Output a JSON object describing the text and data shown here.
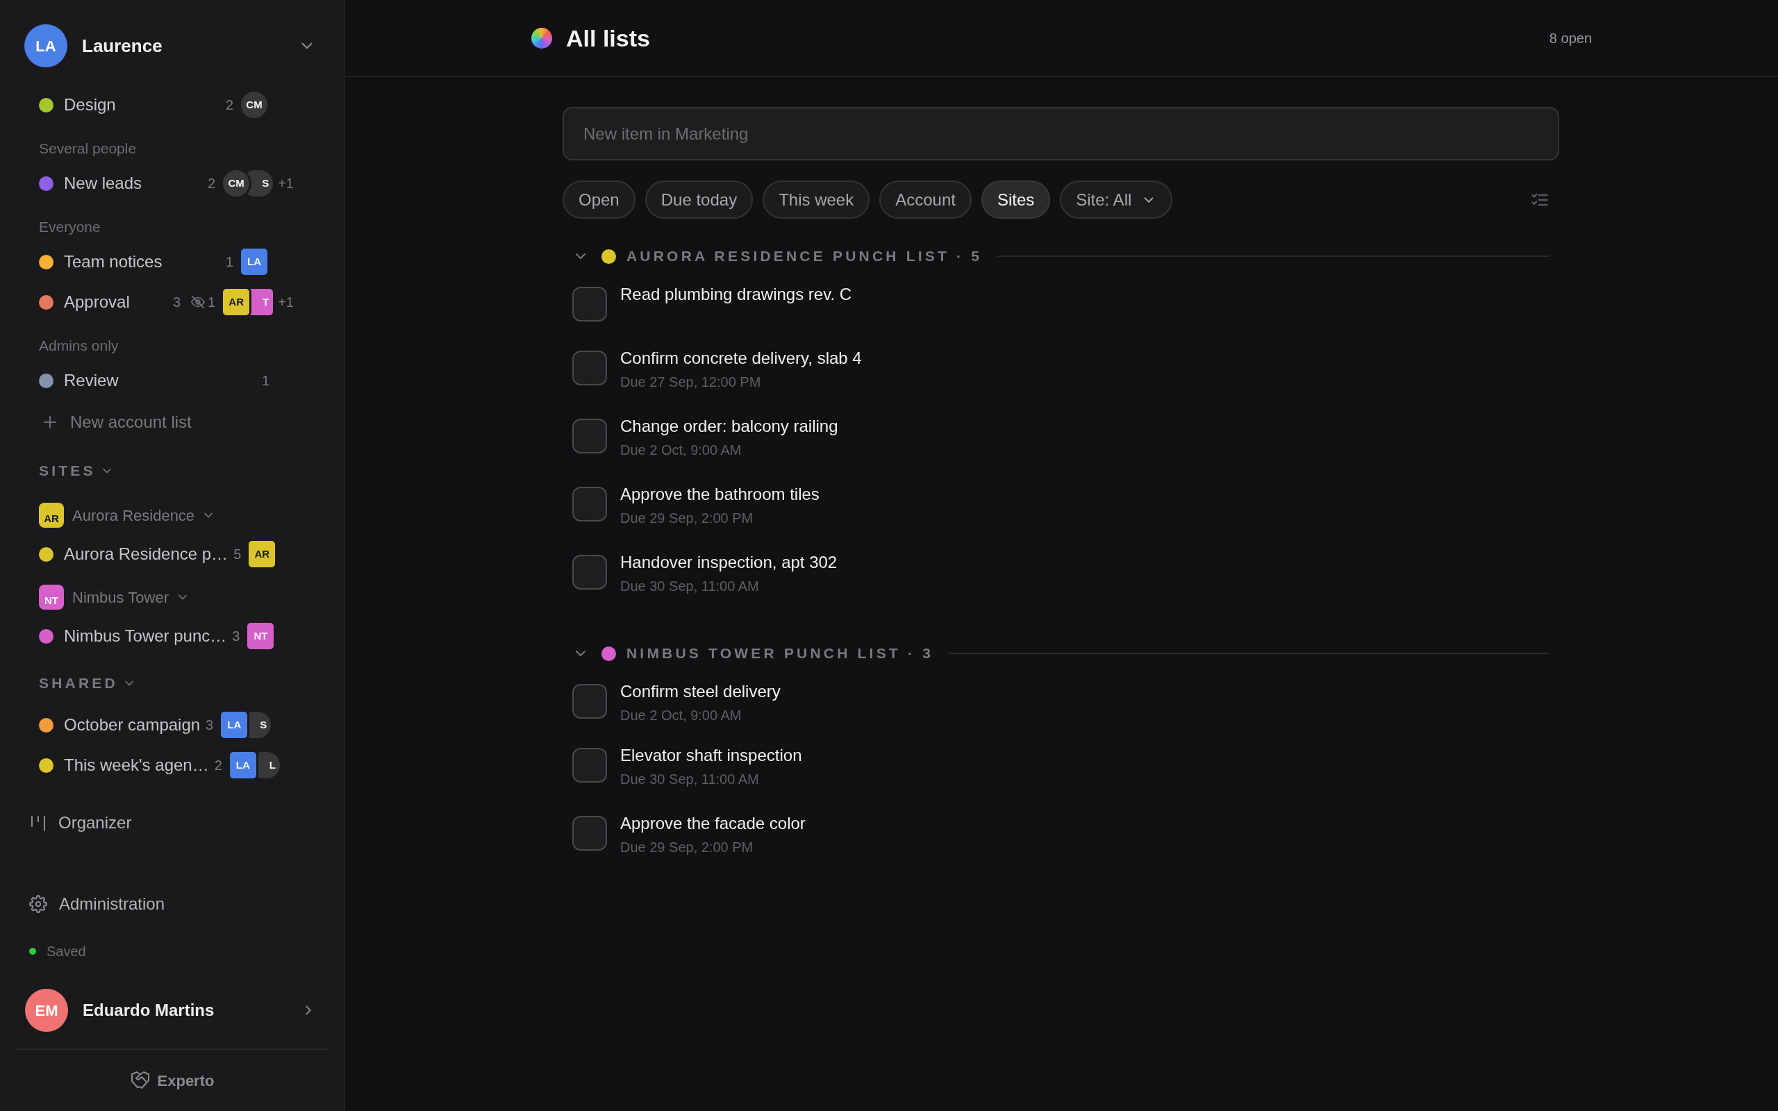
{
  "sidebar": {
    "account": {
      "initials": "LA",
      "name": "Laurence",
      "color": "#4a7fe8"
    },
    "items": [
      {
        "kind": "list",
        "name": "Design",
        "color": "#a3c52d",
        "count": "2",
        "avatars": [
          {
            "initials": "CM",
            "kind": "circle",
            "color": "#38383b",
            "dark_text": false
          }
        ]
      },
      {
        "kind": "label",
        "text": "Several people"
      },
      {
        "kind": "list",
        "name": "New leads",
        "color": "#8f5fe8",
        "count": "2",
        "avatars": [
          {
            "initials": "CM",
            "kind": "circle",
            "color": "#38383b",
            "dark_text": false
          },
          {
            "initials": "S",
            "kind": "circle",
            "color": "#38383b",
            "dark_text": false
          }
        ],
        "more": "+1"
      },
      {
        "kind": "label",
        "text": "Everyone"
      },
      {
        "kind": "list",
        "name": "Team notices",
        "color": "#f5b234",
        "count": "1",
        "avatars": [
          {
            "initials": "LA",
            "kind": "square",
            "color": "#4a7fe8",
            "dark_text": false
          }
        ]
      },
      {
        "kind": "list",
        "name": "Approval",
        "color": "#e07a5f",
        "count": "3",
        "hidden": "1",
        "avatars": [
          {
            "initials": "AR",
            "kind": "square",
            "color": "#dcc52a",
            "dark_text": true
          },
          {
            "initials": "T",
            "kind": "square",
            "color": "#d65fc9",
            "dark_text": false
          }
        ],
        "more": "+1"
      },
      {
        "kind": "label",
        "text": "Admins only"
      },
      {
        "kind": "list",
        "name": "Review",
        "color": "#8493ab",
        "count": "1"
      },
      {
        "kind": "add",
        "text": "New account list"
      },
      {
        "kind": "section",
        "text": "SITES",
        "expanded": true
      },
      {
        "kind": "site",
        "badge": "AR",
        "name": "Aurora Residence",
        "color": "#dcc52a",
        "dark_text": true,
        "expanded": true
      },
      {
        "kind": "list",
        "name": "Aurora Residence p…",
        "color": "#dcc52a",
        "count": "5",
        "avatars": [
          {
            "initials": "AR",
            "kind": "square",
            "color": "#dcc52a",
            "dark_text": true
          }
        ]
      },
      {
        "kind": "site",
        "badge": "NT",
        "name": "Nimbus Tower",
        "color": "#d65fc9",
        "dark_text": false,
        "expanded": true
      },
      {
        "kind": "list",
        "name": "Nimbus Tower punc…",
        "color": "#d65fc9",
        "count": "3",
        "avatars": [
          {
            "initials": "NT",
            "kind": "square",
            "color": "#d65fc9",
            "dark_text": false
          }
        ]
      },
      {
        "kind": "section",
        "text": "SHARED",
        "expanded": true
      },
      {
        "kind": "list",
        "name": "October campaign",
        "color": "#f39c3c",
        "count": "3",
        "avatars": [
          {
            "initials": "LA",
            "kind": "square",
            "color": "#4a7fe8",
            "dark_text": false
          },
          {
            "initials": "S",
            "kind": "circle",
            "color": "#38383b",
            "dark_text": false
          }
        ]
      },
      {
        "kind": "list",
        "name": "This week's agen…",
        "color": "#dcc52a",
        "count": "2",
        "avatars": [
          {
            "initials": "LA",
            "kind": "square",
            "color": "#4a7fe8",
            "dark_text": false
          },
          {
            "initials": "L",
            "kind": "circle",
            "color": "#38383b",
            "dark_text": false
          }
        ]
      }
    ],
    "organizer": "Organizer",
    "administration": "Administration",
    "status": "Saved",
    "user": {
      "initials": "EM",
      "name": "Eduardo Martins",
      "color": "#f07373"
    },
    "footer": "Experto"
  },
  "main": {
    "title": "All lists",
    "open_count": "8 open",
    "new_item": {
      "placeholder": "New item in Marketing"
    },
    "filters": [
      {
        "kind": "chip",
        "label": "Open",
        "selected": false
      },
      {
        "kind": "chip",
        "label": "Due today",
        "selected": false
      },
      {
        "kind": "chip",
        "label": "This week",
        "selected": false
      },
      {
        "kind": "chip",
        "label": "Account",
        "selected": false
      },
      {
        "kind": "chip",
        "label": "Sites",
        "selected": true
      },
      {
        "kind": "dropdown",
        "label": "Site: All",
        "selected": false
      }
    ],
    "groups": [
      {
        "title": "AURORA RESIDENCE PUNCH LIST · 5",
        "color": "#dcc52a",
        "expanded": true,
        "tasks": [
          {
            "title": "Read plumbing drawings rev. C",
            "checked": false
          },
          {
            "title": "Confirm concrete delivery, slab 4",
            "due": "Due 27 Sep, 12:00 PM",
            "checked": false
          },
          {
            "title": "Change order: balcony railing",
            "due": "Due 2 Oct, 9:00 AM",
            "checked": false
          },
          {
            "title": "Approve the bathroom tiles",
            "due": "Due 29 Sep, 2:00 PM",
            "checked": false
          },
          {
            "title": "Handover inspection, apt 302",
            "due": "Due 30 Sep, 11:00 AM",
            "checked": false
          }
        ]
      },
      {
        "title": "NIMBUS TOWER PUNCH LIST · 3",
        "color": "#d65fc9",
        "expanded": true,
        "tasks": [
          {
            "title": "Confirm steel delivery",
            "due": "Due 2 Oct, 9:00 AM",
            "checked": false
          },
          {
            "title": "Elevator shaft inspection",
            "due": "Due 30 Sep, 11:00 AM",
            "checked": false
          },
          {
            "title": "Approve the facade color",
            "due": "Due 29 Sep, 2:00 PM",
            "checked": false
          }
        ]
      }
    ]
  }
}
